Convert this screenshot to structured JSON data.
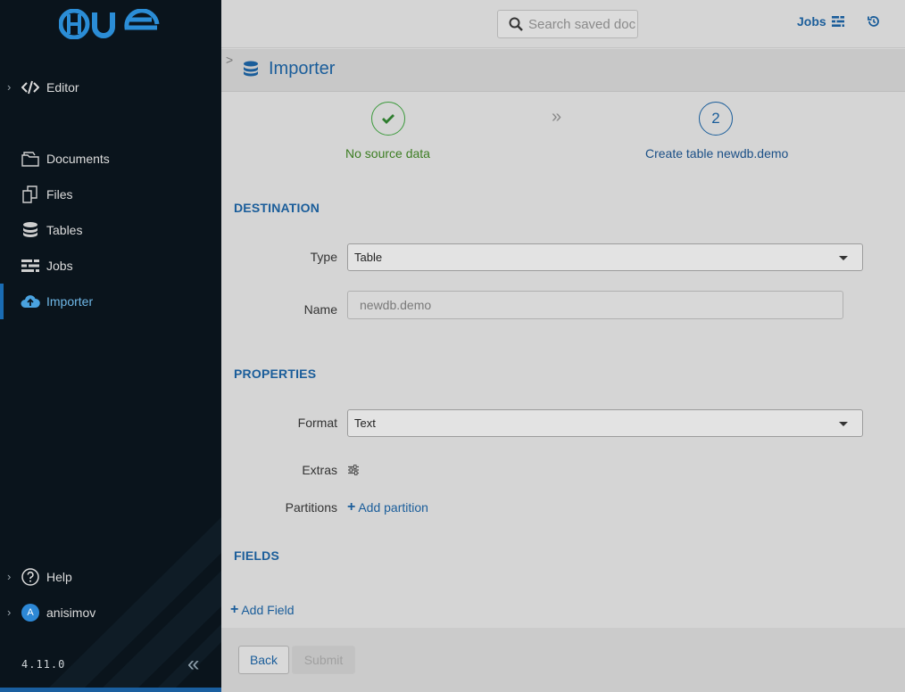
{
  "app": {
    "logo_text": "HUE",
    "version": "4.11.0"
  },
  "sidebar": {
    "editor": {
      "label": "Editor"
    },
    "items": [
      {
        "label": "Documents",
        "icon": "documents-icon"
      },
      {
        "label": "Files",
        "icon": "files-icon"
      },
      {
        "label": "Tables",
        "icon": "database-icon"
      },
      {
        "label": "Jobs",
        "icon": "jobs-icon"
      },
      {
        "label": "Importer",
        "icon": "cloud-upload-icon",
        "active": true
      }
    ],
    "help": {
      "label": "Help"
    },
    "user": {
      "label": "anisimov",
      "initial": "A"
    }
  },
  "topbar": {
    "search_placeholder": "Search saved documents...",
    "jobs_label": "Jobs"
  },
  "header": {
    "title": "Importer"
  },
  "steps": [
    {
      "label": "No source data",
      "status": "complete"
    },
    {
      "number": "2",
      "label": "Create table newdb.demo",
      "status": "current"
    }
  ],
  "destination": {
    "section_title": "DESTINATION",
    "type_label": "Type",
    "type_value": "Table",
    "name_label": "Name",
    "name_placeholder": "newdb.demo"
  },
  "properties": {
    "section_title": "PROPERTIES",
    "format_label": "Format",
    "format_value": "Text",
    "extras_label": "Extras",
    "partitions_label": "Partitions",
    "add_partition_label": "Add partition"
  },
  "fields": {
    "section_title": "FIELDS",
    "add_field_label": "Add Field"
  },
  "footer": {
    "back_label": "Back",
    "submit_label": "Submit"
  },
  "colors": {
    "accent": "#1a5d9a",
    "success": "#3c9a3c",
    "sidebar_bg": "#0a141c",
    "content_bg": "#d5d5d5"
  }
}
